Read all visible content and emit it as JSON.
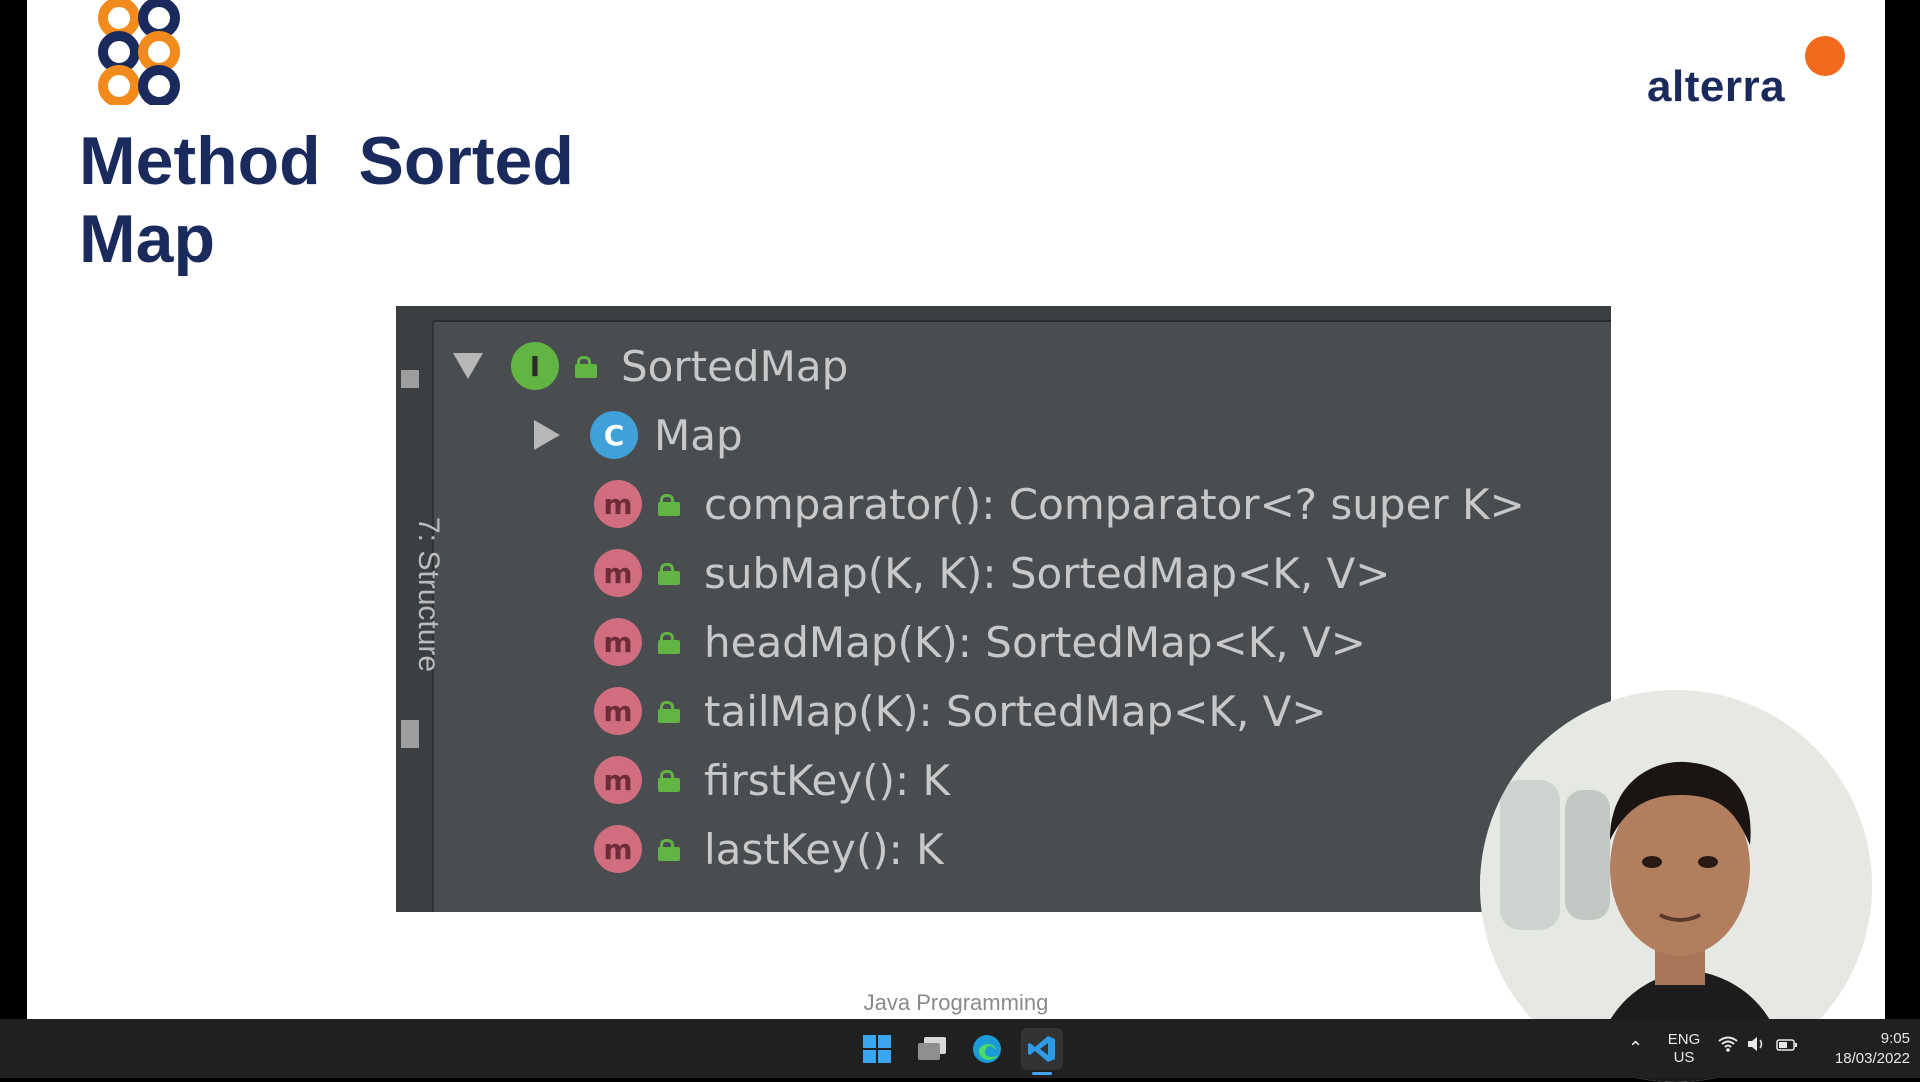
{
  "slide": {
    "title_line1": "Method  Sorted",
    "title_line2": "Map",
    "brand": "alterra",
    "footer": "Java Programming"
  },
  "ide": {
    "side_tool_label": "7: Structure",
    "root": {
      "label": "SortedMap",
      "icon": "interface-icon",
      "badge": "I"
    },
    "parent": {
      "label": "Map",
      "icon": "inherited-interface-icon",
      "badge": "C"
    },
    "methods": [
      {
        "label": "comparator(): Comparator<? super K>",
        "badge": "m"
      },
      {
        "label": "subMap(K, K): SortedMap<K, V>",
        "badge": "m"
      },
      {
        "label": "headMap(K): SortedMap<K, V>",
        "badge": "m"
      },
      {
        "label": "tailMap(K): SortedMap<K, V>",
        "badge": "m"
      },
      {
        "label": "firstKey(): K",
        "badge": "m"
      },
      {
        "label": "lastKey(): K",
        "badge": "m"
      }
    ]
  },
  "taskbar": {
    "apps": [
      "windows-start-icon",
      "task-view-icon",
      "edge-icon",
      "vscode-icon"
    ],
    "lang_line1": "ENG",
    "lang_line2": "US",
    "time": "9:05",
    "date": "18/03/2022"
  },
  "colors": {
    "title": "#1b2a5c",
    "brand_dot": "#f26a1b",
    "ide_bg": "#4a4d50",
    "method_badge": "#d06d7f",
    "interface_badge": "#62b543"
  }
}
